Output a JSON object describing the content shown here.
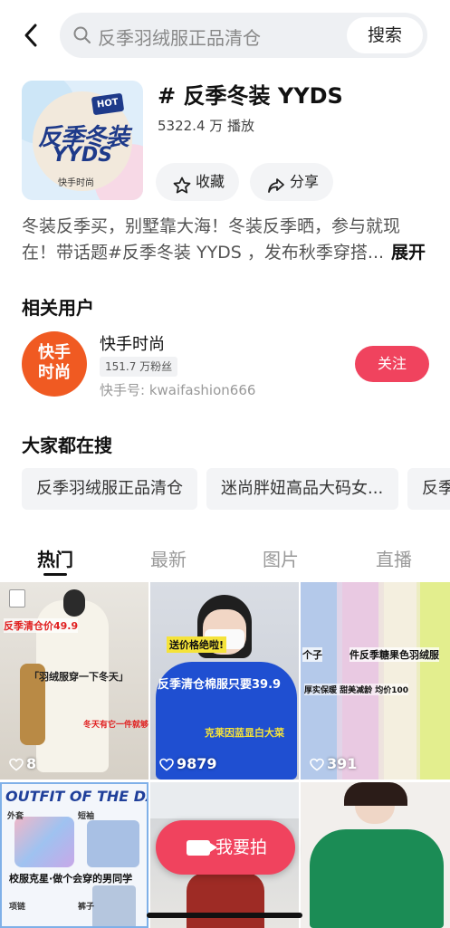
{
  "search": {
    "query": "反季羽绒服正品清仓",
    "button_label": "搜索"
  },
  "topic": {
    "title": "# 反季冬装 YYDS",
    "plays": "5322.4 万 播放",
    "cover_line1": "反季冬装",
    "cover_line2": "YYDS",
    "cover_badge": "HOT",
    "cover_brand": "快手时尚",
    "fav_label": "收藏",
    "share_label": "分享",
    "description": "冬装反季买，别墅靠大海！冬装反季晒，参与就现在！带话题#反季冬装 YYDS ，发布秋季穿搭...",
    "more_label": "展开"
  },
  "related_users": {
    "title": "相关用户",
    "user": {
      "avatar_text": "快手时尚",
      "name": "快手时尚",
      "fans": "151.7 万粉丝",
      "id": "快手号: kwaifashion666",
      "follow_label": "关注"
    }
  },
  "trending": {
    "title": "大家都在搜",
    "chips": [
      "反季羽绒服正品清仓",
      "迷尚胖妞高品大码女...",
      "反季"
    ]
  },
  "tabs": [
    "热门",
    "最新",
    "图片",
    "直播"
  ],
  "grid": [
    {
      "likes": "8",
      "captions": [
        "反季清仓价49.9",
        "「羽绒服穿一下冬天」",
        "冬天有它一件就够"
      ]
    },
    {
      "likes": "9879",
      "captions": [
        "送价格绝啦!",
        "反季清仓棉服只要39.9",
        "克莱因蓝显白大菜"
      ]
    },
    {
      "likes": "391",
      "captions": [
        "个子",
        "件反季糖果色羽绒服",
        "厚实保暖 甜美减龄 均价100"
      ]
    },
    {
      "likes": "",
      "captions": [
        "OUTFIT OF THE DAY",
        "校服克星·做个会穿的男同学",
        "外套",
        "短袖",
        "项链",
        "裤子"
      ]
    },
    {
      "likes": "",
      "captions": []
    },
    {
      "likes": "",
      "captions": []
    }
  ],
  "fab": {
    "label": "我要拍"
  },
  "colors": {
    "accent": "#f0435e",
    "avatar_bg": "#f05a22"
  }
}
